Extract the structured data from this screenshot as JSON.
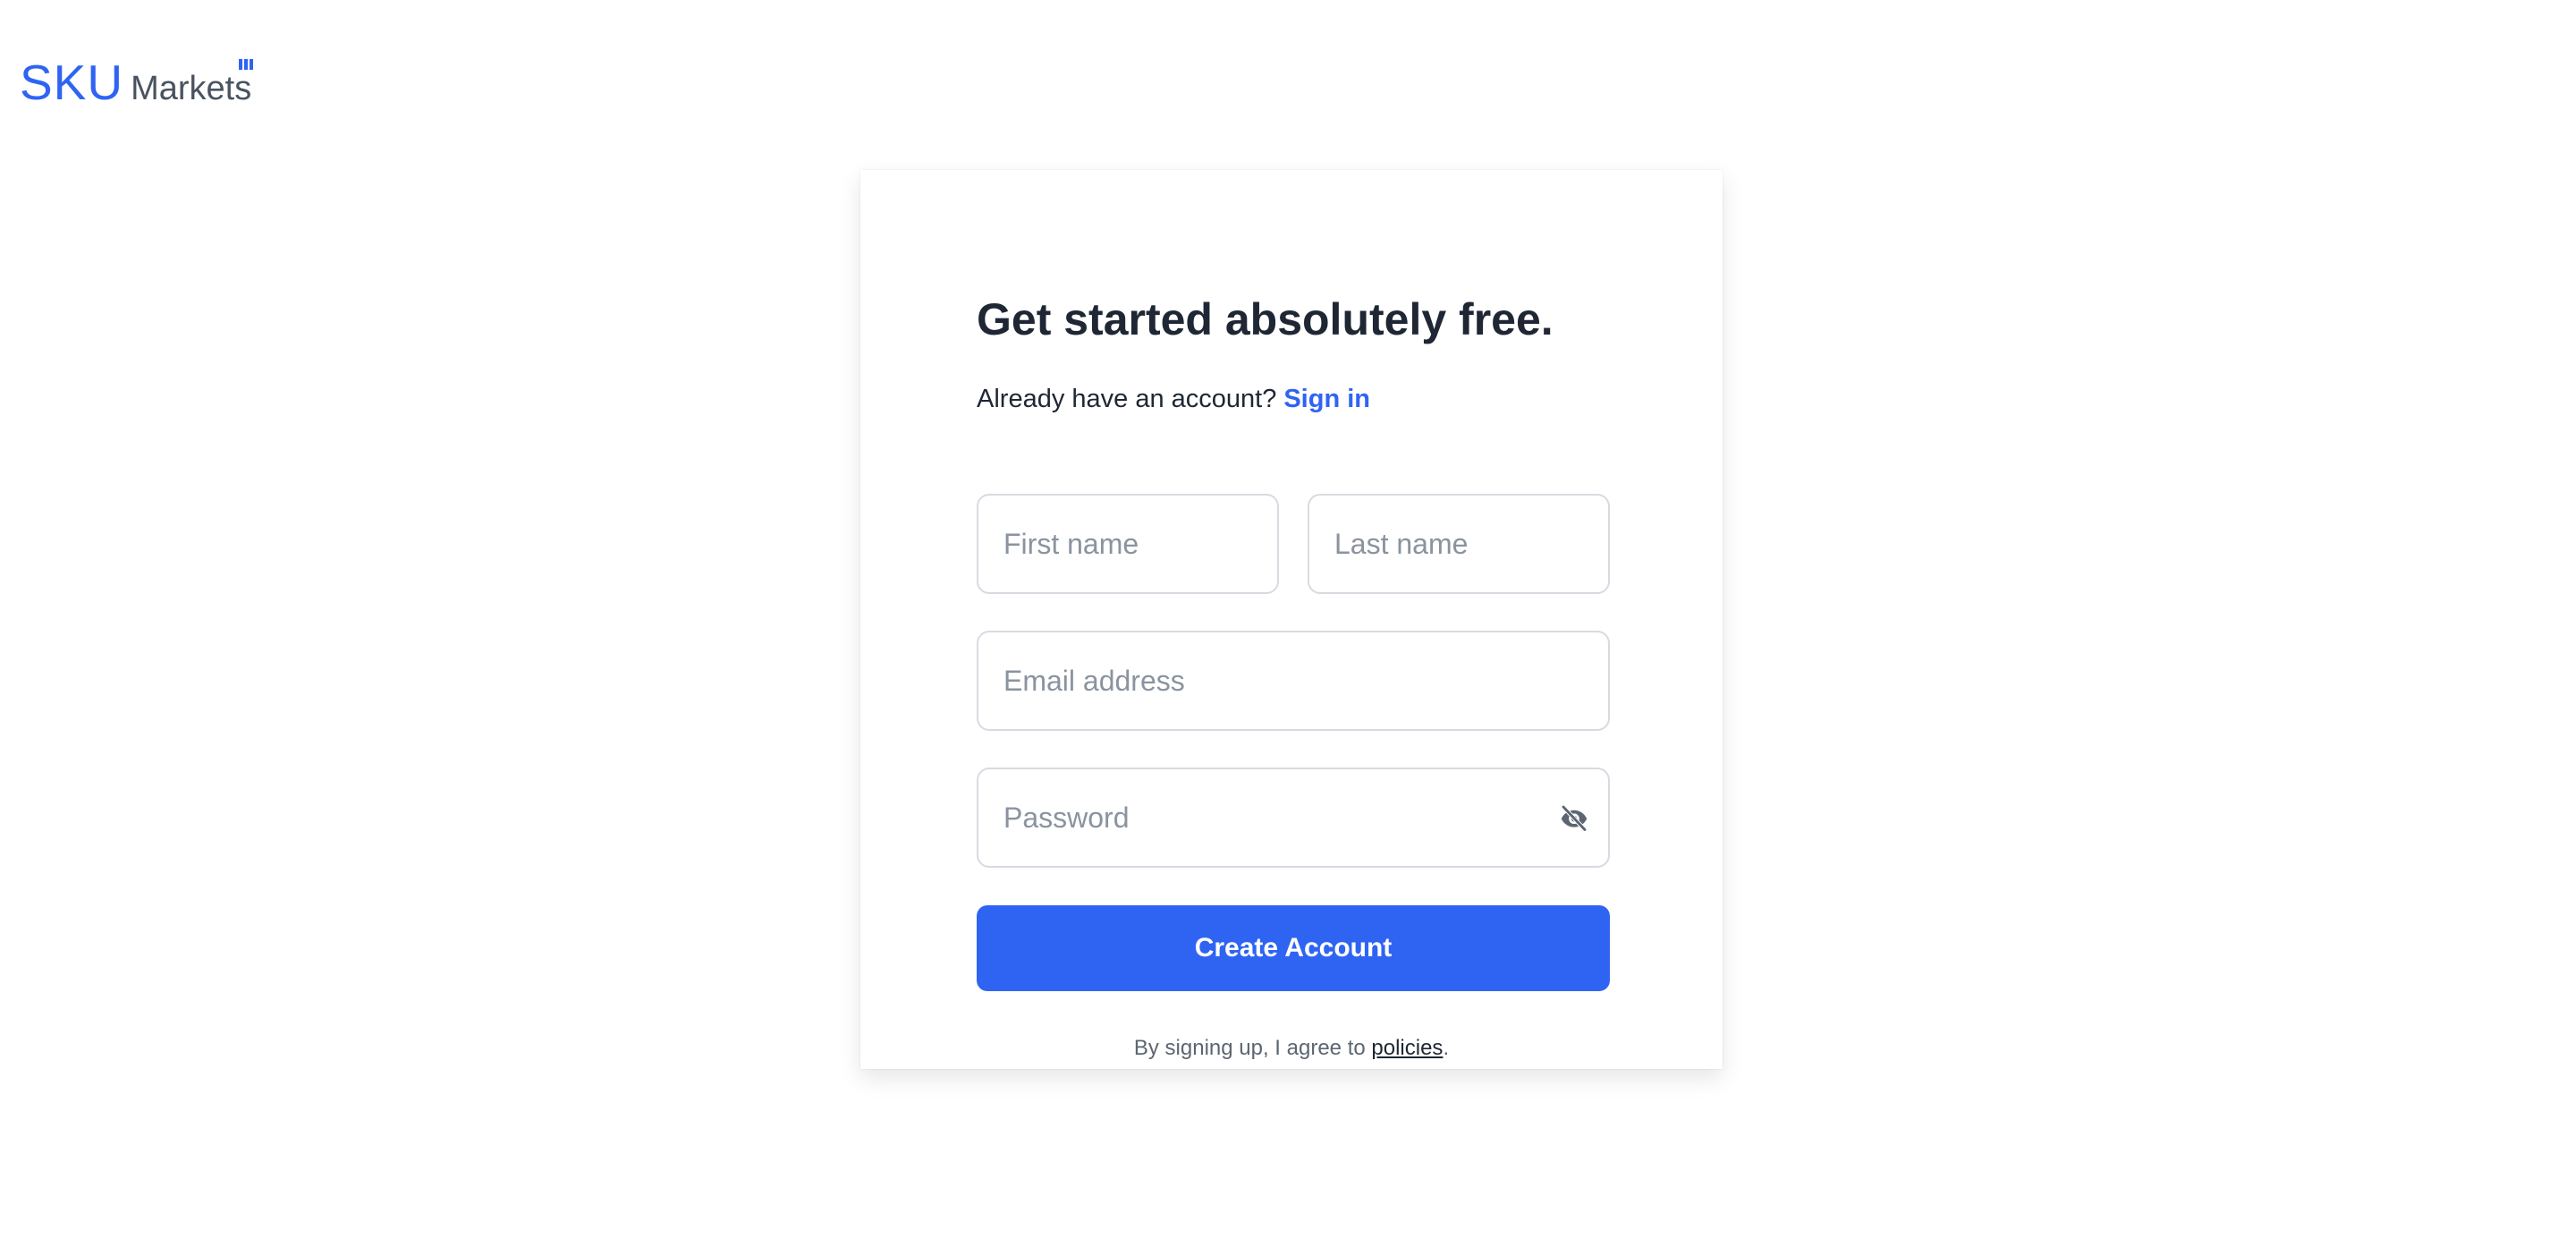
{
  "brand": {
    "name_primary": "SKU",
    "name_secondary": "Markets",
    "accent_color": "#2f64f3"
  },
  "form": {
    "heading": "Get started absolutely free.",
    "signin_prompt": "Already have an account?",
    "signin_link": "Sign in",
    "first_name": {
      "placeholder": "First name",
      "value": ""
    },
    "last_name": {
      "placeholder": "Last name",
      "value": ""
    },
    "email": {
      "placeholder": "Email address",
      "value": ""
    },
    "password": {
      "placeholder": "Password",
      "value": "",
      "toggle_icon": "eye-off-icon"
    },
    "submit_label": "Create Account",
    "terms_prefix": "By signing up, I agree to",
    "terms_link": "policies",
    "terms_suffix": "."
  }
}
